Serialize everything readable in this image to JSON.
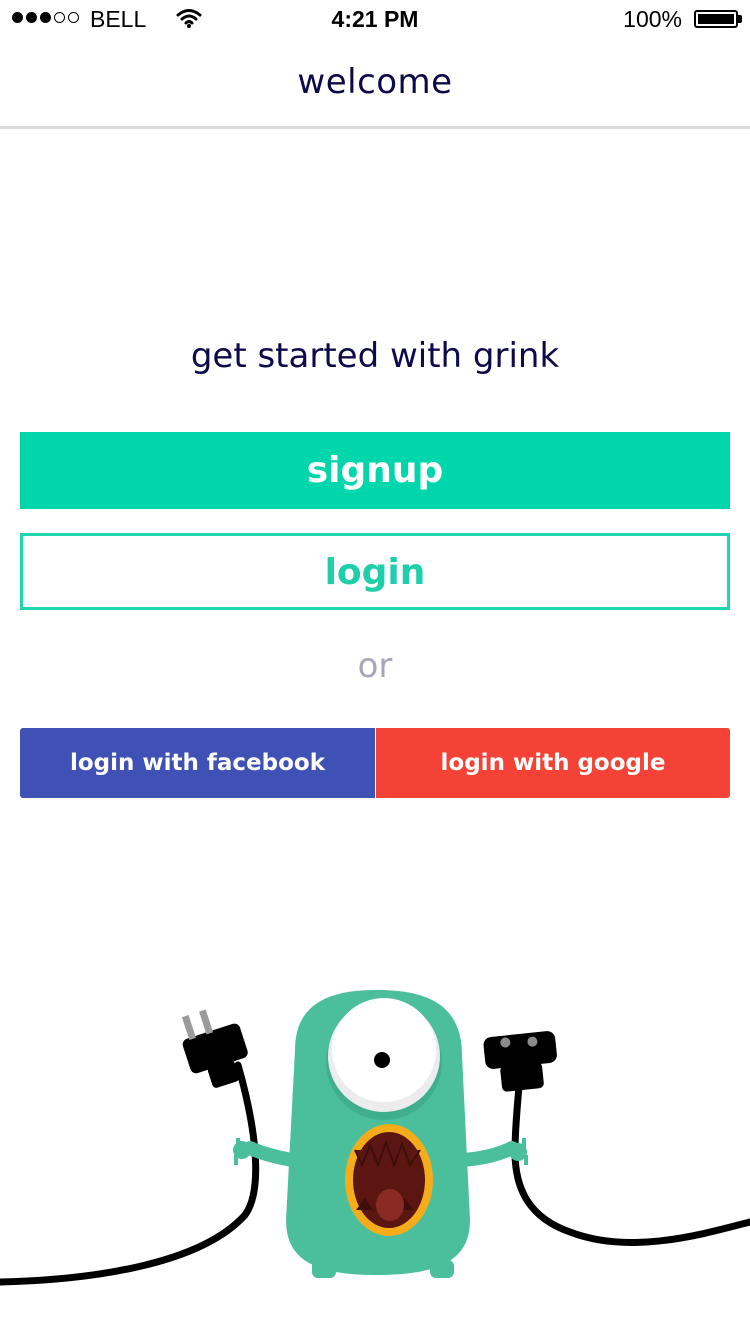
{
  "status_bar": {
    "carrier": "BELL",
    "time": "4:21 PM",
    "battery": "100%",
    "signal_dots_filled": 3,
    "signal_dots_total": 5
  },
  "nav": {
    "title": "welcome"
  },
  "main": {
    "tagline": "get started with grink",
    "signup_label": "signup",
    "login_label": "login",
    "or_label": "or",
    "facebook_label": "login with facebook",
    "google_label": "login with google"
  },
  "colors": {
    "accent": "#00d6ac",
    "title": "#0c0a4a",
    "facebook": "#3f51b5",
    "google": "#f44336",
    "or_text": "#a6a7b8",
    "monster": "#4bbf9b"
  },
  "icons": {
    "signal": "signal-dots-icon",
    "wifi": "wifi-icon",
    "battery": "battery-icon",
    "mascot": "monster-with-plugs-illustration"
  }
}
